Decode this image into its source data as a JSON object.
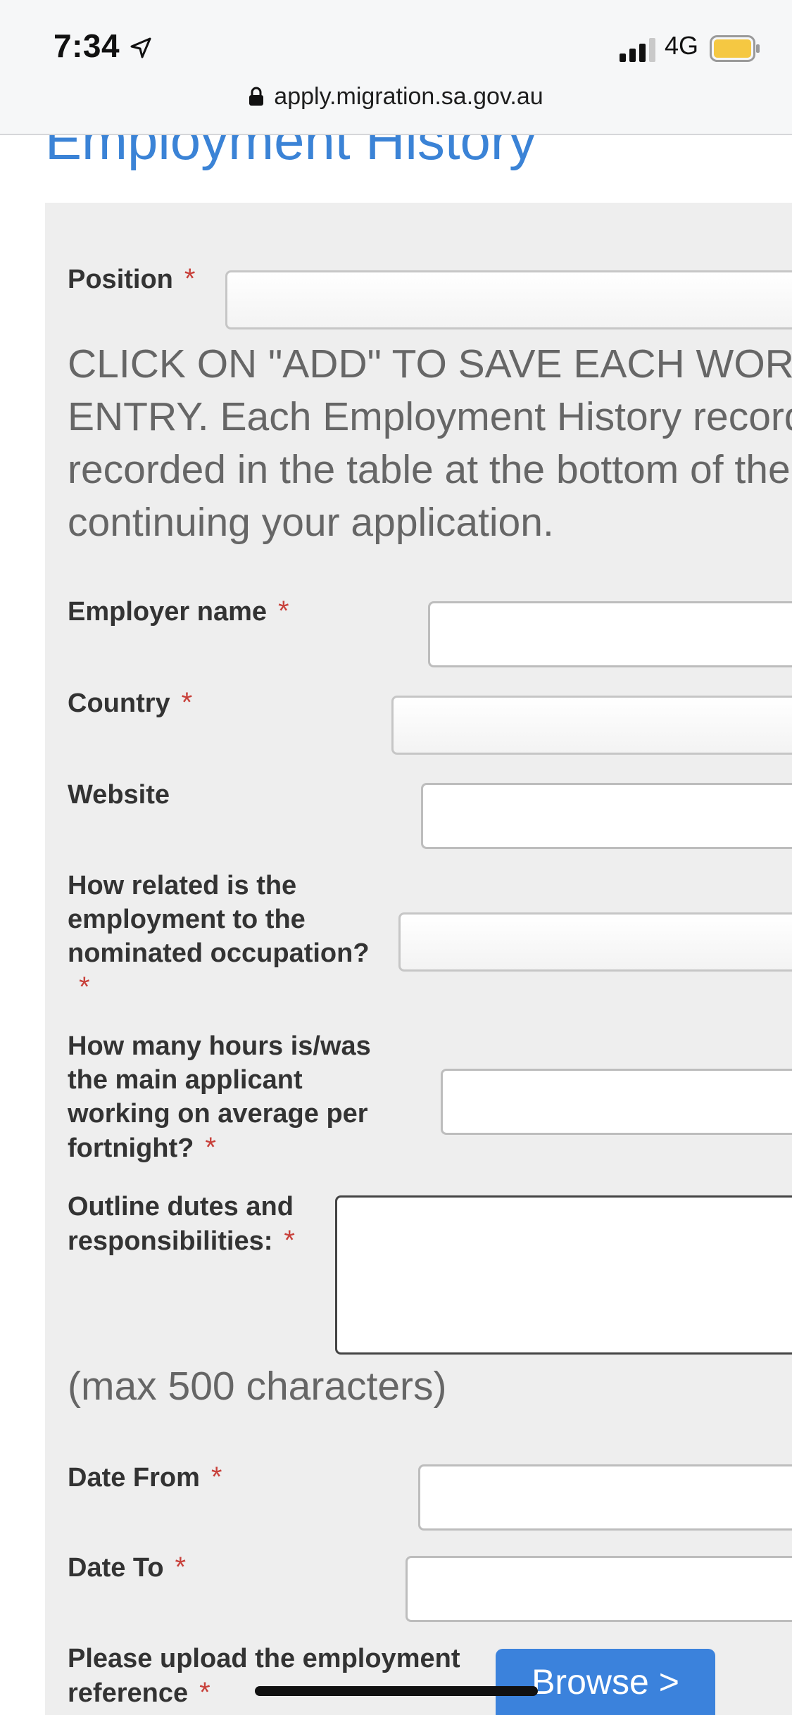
{
  "status_bar": {
    "time": "7:34",
    "network": "4G",
    "icons": [
      "location-arrow-icon",
      "signal-bars-icon",
      "battery-icon"
    ],
    "battery_color": "#f5c842"
  },
  "url_bar": {
    "url": "apply.migration.sa.gov.au",
    "icon": "lock-icon"
  },
  "page": {
    "title": "Employment History",
    "notice": "CLICK ON \"ADD\" TO SAVE EACH WORK\nENTRY. Each Employment History record\nrecorded in the table at the bottom of the\ncontinuing your application.",
    "hint": "(max 500 characters)"
  },
  "form": {
    "required_marker": "*",
    "position": {
      "label": "Position",
      "value": ""
    },
    "employer_name": {
      "label": "Employer name",
      "value": ""
    },
    "country": {
      "label": "Country",
      "value": ""
    },
    "website": {
      "label": "Website",
      "value": ""
    },
    "relation": {
      "label": "How related is the employment to the nominated occupation?",
      "value": ""
    },
    "hours": {
      "label": "How many hours is/was the main applicant working on average per fortnight?",
      "value": ""
    },
    "duties": {
      "label": "Outline dutes and responsibilities:",
      "value": ""
    },
    "date_from": {
      "label": "Date From",
      "value": ""
    },
    "date_to": {
      "label": "Date To",
      "value": ""
    },
    "upload": {
      "label": "Please upload the employment reference",
      "button": "Browse >"
    }
  },
  "colors": {
    "title": "#3b83d6",
    "panel": "#eeeeee",
    "required": "#c8403a",
    "button": "#3b82dc"
  }
}
